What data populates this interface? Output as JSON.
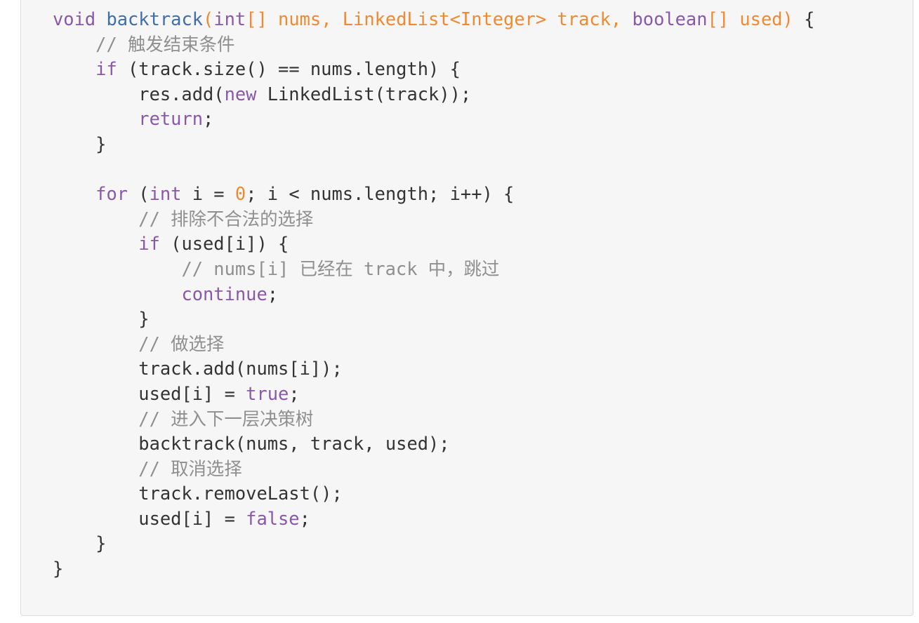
{
  "code": {
    "language": "java",
    "lines": [
      [
        {
          "t": "kw",
          "v": "void"
        },
        {
          "t": "pl",
          "v": " "
        },
        {
          "t": "fn",
          "v": "backtrack"
        },
        {
          "t": "pa",
          "v": "("
        },
        {
          "t": "ty",
          "v": "int"
        },
        {
          "t": "pa",
          "v": "[] nums, LinkedList<Integer> track, "
        },
        {
          "t": "ty",
          "v": "boolean"
        },
        {
          "t": "pa",
          "v": "[] used)"
        },
        {
          "t": "pl",
          "v": " {"
        }
      ],
      [
        {
          "t": "pl",
          "v": "    "
        },
        {
          "t": "co",
          "v": "// 触发结束条件"
        }
      ],
      [
        {
          "t": "pl",
          "v": "    "
        },
        {
          "t": "kw",
          "v": "if"
        },
        {
          "t": "pl",
          "v": " (track.size() == nums.length) {"
        }
      ],
      [
        {
          "t": "pl",
          "v": "        res.add("
        },
        {
          "t": "kw",
          "v": "new"
        },
        {
          "t": "pl",
          "v": " LinkedList(track));"
        }
      ],
      [
        {
          "t": "pl",
          "v": "        "
        },
        {
          "t": "kw",
          "v": "return"
        },
        {
          "t": "pl",
          "v": ";"
        }
      ],
      [
        {
          "t": "pl",
          "v": "    }"
        }
      ],
      [
        {
          "t": "pl",
          "v": ""
        }
      ],
      [
        {
          "t": "pl",
          "v": "    "
        },
        {
          "t": "kw",
          "v": "for"
        },
        {
          "t": "pl",
          "v": " ("
        },
        {
          "t": "ty",
          "v": "int"
        },
        {
          "t": "pl",
          "v": " i = "
        },
        {
          "t": "nu",
          "v": "0"
        },
        {
          "t": "pl",
          "v": "; i < nums.length; i++) {"
        }
      ],
      [
        {
          "t": "pl",
          "v": "        "
        },
        {
          "t": "co",
          "v": "// 排除不合法的选择"
        }
      ],
      [
        {
          "t": "pl",
          "v": "        "
        },
        {
          "t": "kw",
          "v": "if"
        },
        {
          "t": "pl",
          "v": " (used[i]) {"
        }
      ],
      [
        {
          "t": "pl",
          "v": "            "
        },
        {
          "t": "co",
          "v": "// nums[i] 已经在 track 中，跳过"
        }
      ],
      [
        {
          "t": "pl",
          "v": "            "
        },
        {
          "t": "kw",
          "v": "continue"
        },
        {
          "t": "pl",
          "v": ";"
        }
      ],
      [
        {
          "t": "pl",
          "v": "        }"
        }
      ],
      [
        {
          "t": "pl",
          "v": "        "
        },
        {
          "t": "co",
          "v": "// 做选择"
        }
      ],
      [
        {
          "t": "pl",
          "v": "        track.add(nums[i]);"
        }
      ],
      [
        {
          "t": "pl",
          "v": "        used[i] = "
        },
        {
          "t": "kw",
          "v": "true"
        },
        {
          "t": "pl",
          "v": ";"
        }
      ],
      [
        {
          "t": "pl",
          "v": "        "
        },
        {
          "t": "co",
          "v": "// 进入下一层决策树"
        }
      ],
      [
        {
          "t": "pl",
          "v": "        backtrack(nums, track, used);"
        }
      ],
      [
        {
          "t": "pl",
          "v": "        "
        },
        {
          "t": "co",
          "v": "// 取消选择"
        }
      ],
      [
        {
          "t": "pl",
          "v": "        track.removeLast();"
        }
      ],
      [
        {
          "t": "pl",
          "v": "        used[i] = "
        },
        {
          "t": "kw",
          "v": "false"
        },
        {
          "t": "pl",
          "v": ";"
        }
      ],
      [
        {
          "t": "pl",
          "v": "    }"
        }
      ],
      [
        {
          "t": "pl",
          "v": "}"
        }
      ]
    ]
  }
}
